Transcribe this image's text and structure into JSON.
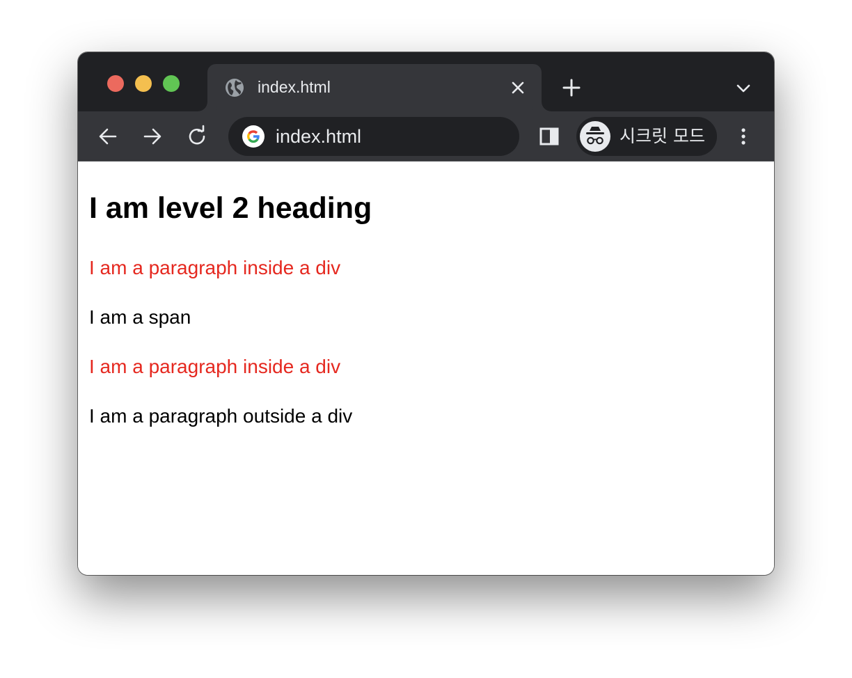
{
  "window": {
    "tab": {
      "title": "index.html",
      "icon": "globe-icon"
    },
    "toolbar": {
      "address": "index.html",
      "incognito_label": "시크릿 모드"
    },
    "colors": {
      "tabstrip": "#202124",
      "toolbar": "#35363a",
      "paragraph_red": "#e5281f"
    }
  },
  "page": {
    "heading": "I am level 2 heading",
    "div_paragraph_1": "I am a paragraph inside a div",
    "span_text": "I am a span",
    "div_paragraph_2": "I am a paragraph inside a div",
    "outside_paragraph": "I am a paragraph outside a div"
  }
}
